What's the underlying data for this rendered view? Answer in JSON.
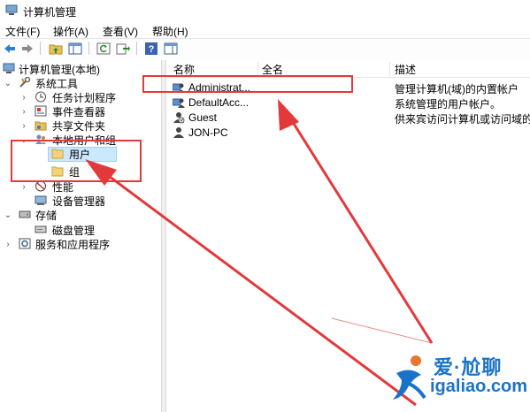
{
  "window": {
    "title": "计算机管理"
  },
  "menu": [
    "文件(F)",
    "操作(A)",
    "查看(V)",
    "帮助(H)"
  ],
  "toolbar": {
    "buttons": [
      "back-icon",
      "forward-icon",
      "up-folder-icon",
      "show-hide-tree-icon",
      "refresh-icon",
      "export-list-icon",
      "help-icon",
      "show-action-pane-icon"
    ]
  },
  "tree": {
    "root": "计算机管理(本地)",
    "system_tools": "系统工具",
    "task_scheduler": "任务计划程序",
    "event_viewer": "事件查看器",
    "shared_folders": "共享文件夹",
    "local_users_groups": "本地用户和组",
    "users": "用户",
    "groups": "组",
    "performance": "性能",
    "device_manager": "设备管理器",
    "storage": "存储",
    "disk_management": "磁盘管理",
    "services_apps": "服务和应用程序"
  },
  "list": {
    "columns": [
      "名称",
      "全名",
      "描述"
    ],
    "rows": [
      {
        "name": "Administrat...",
        "fullname": "",
        "desc": "管理计算机(域)的内置帐户"
      },
      {
        "name": "DefaultAcc...",
        "fullname": "",
        "desc": "系统管理的用户帐户。"
      },
      {
        "name": "Guest",
        "fullname": "",
        "desc": "供来宾访问计算机或访问域的"
      },
      {
        "name": "JON-PC",
        "fullname": "",
        "desc": ""
      }
    ]
  },
  "watermark": {
    "top": "爱·尬聊",
    "bottom": "igaliao.com"
  },
  "colors": {
    "annotation": "#e23a3a",
    "selection": "#cce8ff",
    "brand": "#1a73c8"
  }
}
